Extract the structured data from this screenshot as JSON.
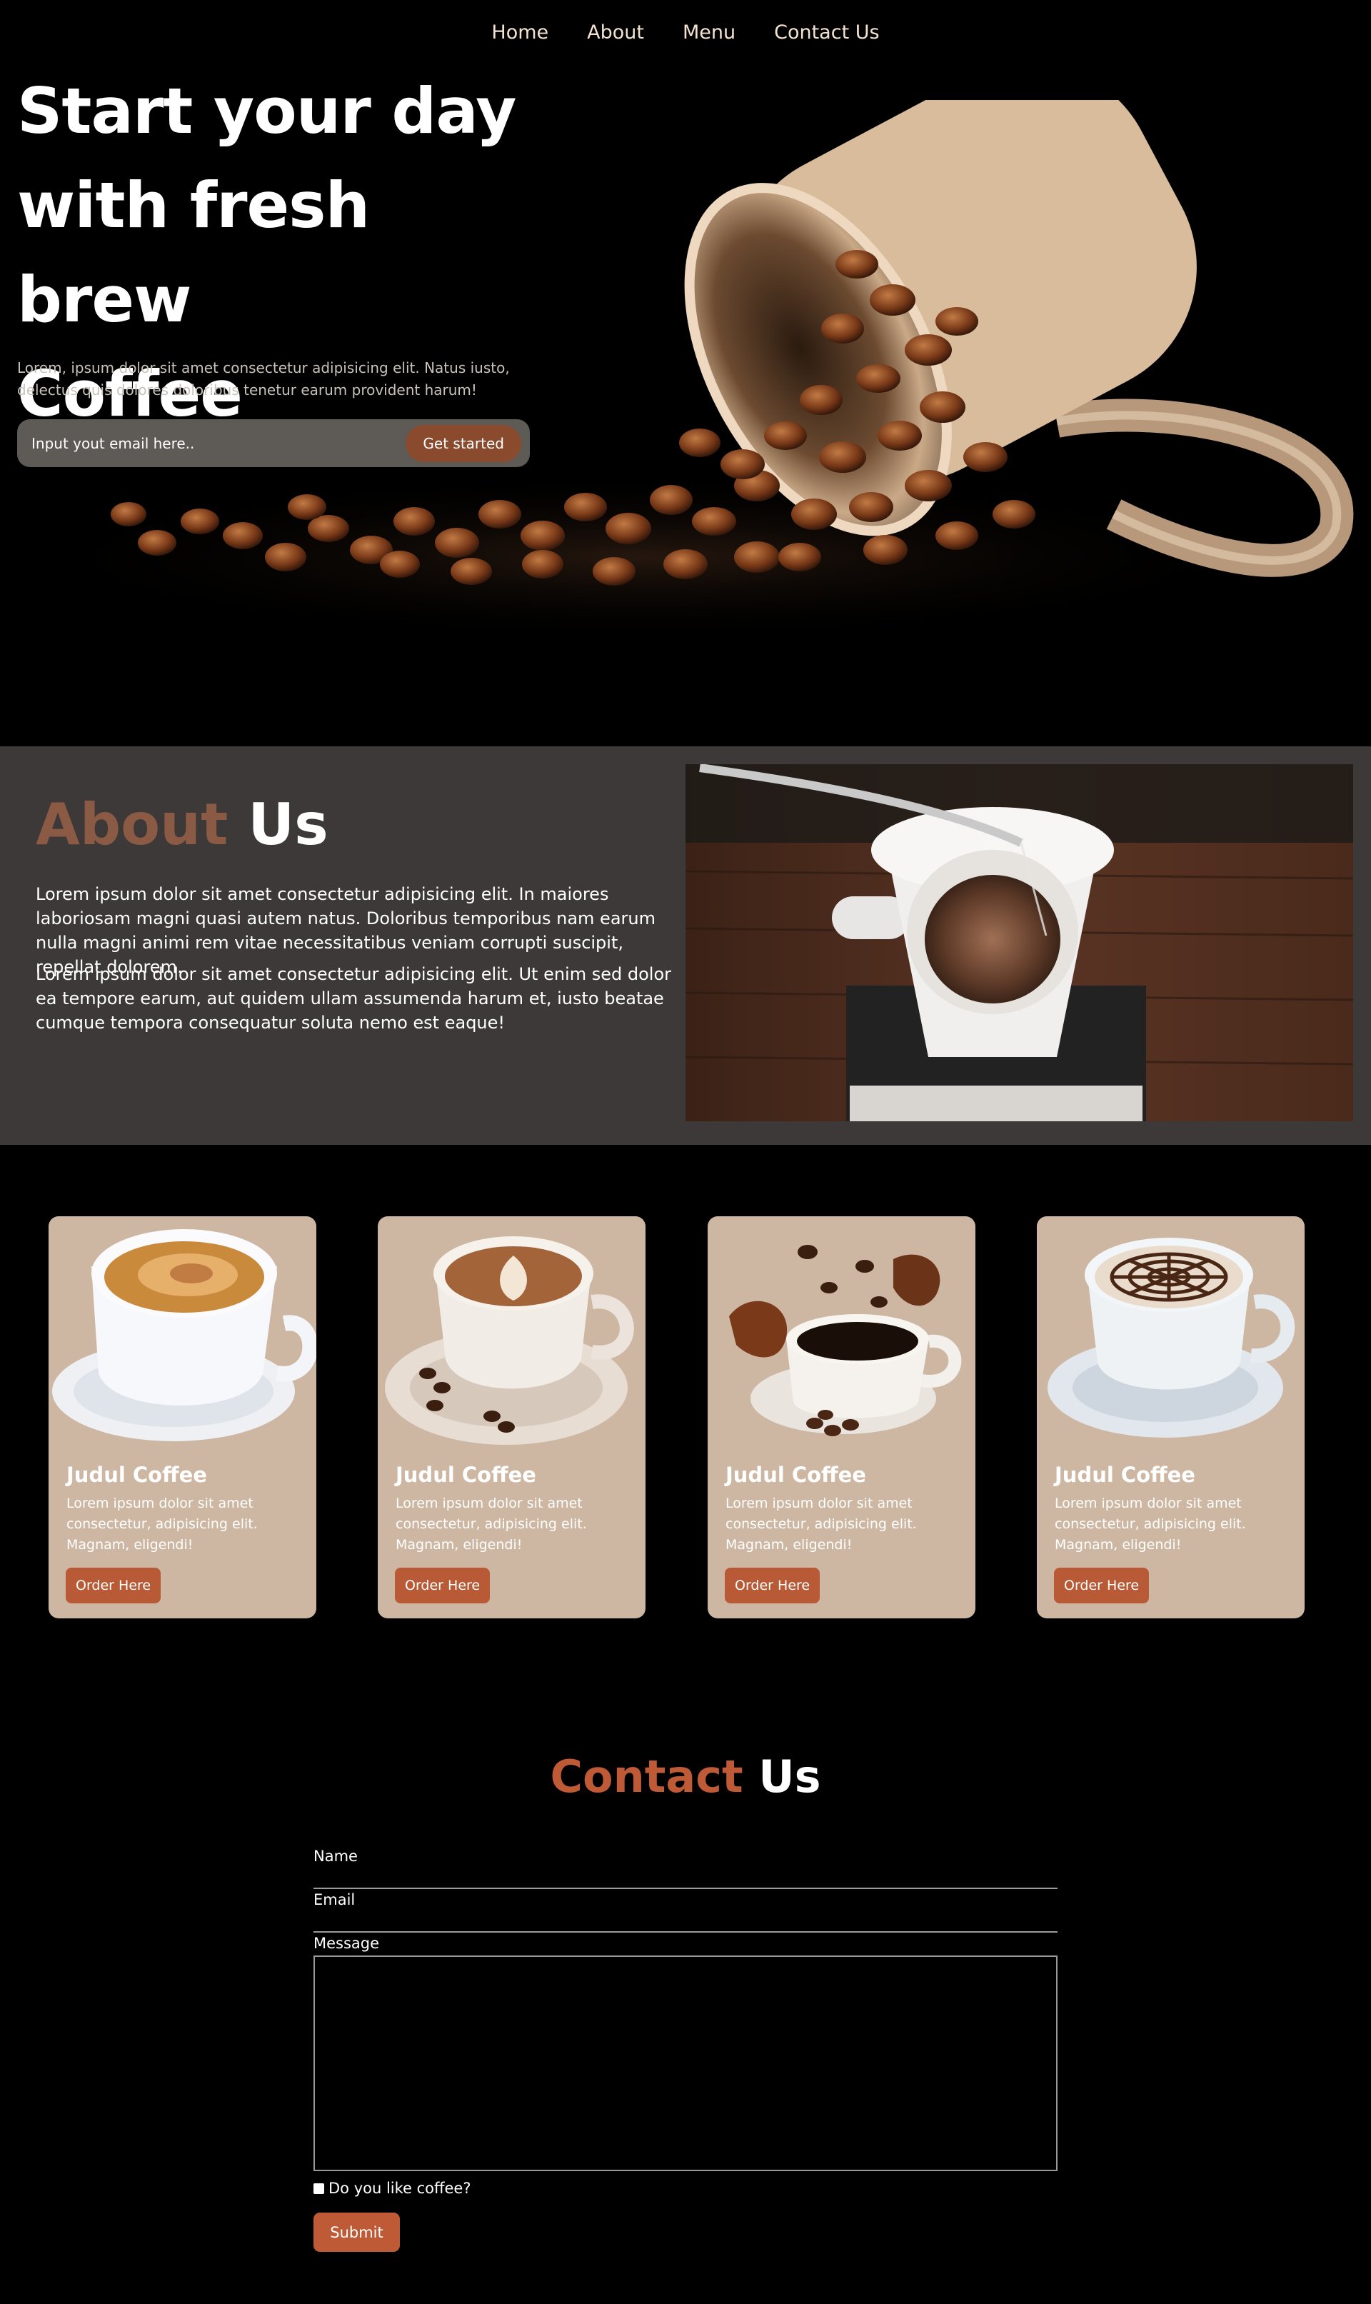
{
  "nav": {
    "items": [
      "Home",
      "About",
      "Menu",
      "Contact Us"
    ]
  },
  "hero": {
    "title_lines": [
      "Start your day",
      "with fresh brew",
      "Coffee"
    ],
    "description": "Lorem, ipsum dolor sit amet consectetur adipisicing elit. Natus iusto, delectus quis dolores doloribus tenetur earum provident harum!",
    "email_placeholder": "Input yout email here..",
    "cta_label": "Get started"
  },
  "about": {
    "title_accent": "About",
    "title_plain": "Us",
    "paragraphs": [
      "Lorem ipsum dolor sit amet consectetur adipisicing elit. In maiores laboriosam magni quasi autem natus. Doloribus temporibus nam earum nulla magni animi rem vitae necessitatibus veniam corrupti suscipit, repellat dolorem.",
      "Lorem ipsum dolor sit amet consectetur adipisicing elit. Ut enim sed dolor ea tempore earum, aut quidem ullam assumenda harum et, iusto beatae cumque tempora consequatur soluta nemo est eaque!"
    ]
  },
  "products": [
    {
      "title": "Judul Coffee",
      "text": "Lorem ipsum dolor sit amet consectetur, adipisicing elit. Magnam, eligendi!",
      "button": "Order Here"
    },
    {
      "title": "Judul Coffee",
      "text": "Lorem ipsum dolor sit amet consectetur, adipisicing elit. Magnam, eligendi!",
      "button": "Order Here"
    },
    {
      "title": "Judul Coffee",
      "text": "Lorem ipsum dolor sit amet consectetur, adipisicing elit. Magnam, eligendi!",
      "button": "Order Here"
    },
    {
      "title": "Judul Coffee",
      "text": "Lorem ipsum dolor sit amet consectetur, adipisicing elit. Magnam, eligendi!",
      "button": "Order Here"
    }
  ],
  "contact": {
    "title_accent": "Contact",
    "title_plain": "Us",
    "name_label": "Name",
    "email_label": "Email",
    "message_label": "Message",
    "checkbox_label": "Do you like coffee?",
    "submit_label": "Submit"
  },
  "colors": {
    "background": "#000000",
    "about_bg": "#3d3938",
    "card_bg": "#cdb7a2",
    "accent_brown": "#8a5a44",
    "accent_orange": "#bf5a36",
    "nav_text": "#f3e2cf"
  }
}
